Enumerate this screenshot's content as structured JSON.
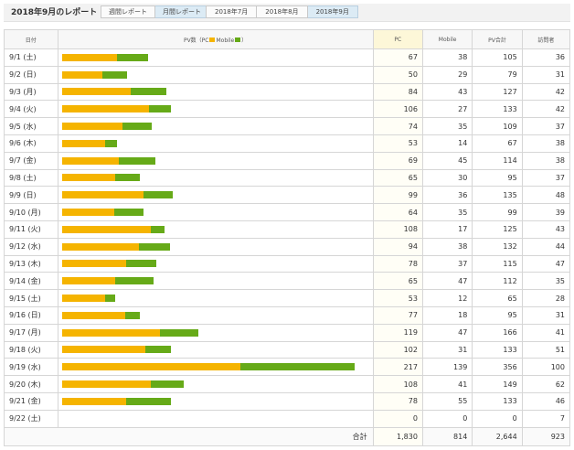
{
  "page_title": "2018年9月のレポート",
  "report_tabs": [
    "週間レポート",
    "月間レポート"
  ],
  "active_report_tab": 1,
  "month_tabs": [
    "2018年7月",
    "2018年8月",
    "2018年9月"
  ],
  "active_month_tab": 2,
  "colors": {
    "pc": "#f5b400",
    "mobile": "#66aa18"
  },
  "headers": {
    "date": "日付",
    "pv_prefix": "PV数（PC",
    "pv_mobile": "Mobile",
    "pv_suffix": "）",
    "pc": "PC",
    "mobile": "Mobile",
    "pv_total": "PV合計",
    "visitors": "訪問者"
  },
  "rows": [
    {
      "date": "9/1 (土)",
      "pc": "67",
      "mobile": "38",
      "total": "105",
      "visitors": "36",
      "pc_val": 67,
      "mobile_val": 38
    },
    {
      "date": "9/2 (日)",
      "pc": "50",
      "mobile": "29",
      "total": "79",
      "visitors": "31",
      "pc_val": 50,
      "mobile_val": 29
    },
    {
      "date": "9/3 (月)",
      "pc": "84",
      "mobile": "43",
      "total": "127",
      "visitors": "42",
      "pc_val": 84,
      "mobile_val": 43
    },
    {
      "date": "9/4 (火)",
      "pc": "106",
      "mobile": "27",
      "total": "133",
      "visitors": "42",
      "pc_val": 106,
      "mobile_val": 27
    },
    {
      "date": "9/5 (水)",
      "pc": "74",
      "mobile": "35",
      "total": "109",
      "visitors": "37",
      "pc_val": 74,
      "mobile_val": 35
    },
    {
      "date": "9/6 (木)",
      "pc": "53",
      "mobile": "14",
      "total": "67",
      "visitors": "38",
      "pc_val": 53,
      "mobile_val": 14
    },
    {
      "date": "9/7 (金)",
      "pc": "69",
      "mobile": "45",
      "total": "114",
      "visitors": "38",
      "pc_val": 69,
      "mobile_val": 45
    },
    {
      "date": "9/8 (土)",
      "pc": "65",
      "mobile": "30",
      "total": "95",
      "visitors": "37",
      "pc_val": 65,
      "mobile_val": 30
    },
    {
      "date": "9/9 (日)",
      "pc": "99",
      "mobile": "36",
      "total": "135",
      "visitors": "48",
      "pc_val": 99,
      "mobile_val": 36
    },
    {
      "date": "9/10 (月)",
      "pc": "64",
      "mobile": "35",
      "total": "99",
      "visitors": "39",
      "pc_val": 64,
      "mobile_val": 35
    },
    {
      "date": "9/11 (火)",
      "pc": "108",
      "mobile": "17",
      "total": "125",
      "visitors": "43",
      "pc_val": 108,
      "mobile_val": 17
    },
    {
      "date": "9/12 (水)",
      "pc": "94",
      "mobile": "38",
      "total": "132",
      "visitors": "44",
      "pc_val": 94,
      "mobile_val": 38
    },
    {
      "date": "9/13 (木)",
      "pc": "78",
      "mobile": "37",
      "total": "115",
      "visitors": "47",
      "pc_val": 78,
      "mobile_val": 37
    },
    {
      "date": "9/14 (金)",
      "pc": "65",
      "mobile": "47",
      "total": "112",
      "visitors": "35",
      "pc_val": 65,
      "mobile_val": 47
    },
    {
      "date": "9/15 (土)",
      "pc": "53",
      "mobile": "12",
      "total": "65",
      "visitors": "28",
      "pc_val": 53,
      "mobile_val": 12
    },
    {
      "date": "9/16 (日)",
      "pc": "77",
      "mobile": "18",
      "total": "95",
      "visitors": "31",
      "pc_val": 77,
      "mobile_val": 18
    },
    {
      "date": "9/17 (月)",
      "pc": "119",
      "mobile": "47",
      "total": "166",
      "visitors": "41",
      "pc_val": 119,
      "mobile_val": 47
    },
    {
      "date": "9/18 (火)",
      "pc": "102",
      "mobile": "31",
      "total": "133",
      "visitors": "51",
      "pc_val": 102,
      "mobile_val": 31
    },
    {
      "date": "9/19 (水)",
      "pc": "217",
      "mobile": "139",
      "total": "356",
      "visitors": "100",
      "pc_val": 217,
      "mobile_val": 139
    },
    {
      "date": "9/20 (木)",
      "pc": "108",
      "mobile": "41",
      "total": "149",
      "visitors": "62",
      "pc_val": 108,
      "mobile_val": 41
    },
    {
      "date": "9/21 (金)",
      "pc": "78",
      "mobile": "55",
      "total": "133",
      "visitors": "46",
      "pc_val": 78,
      "mobile_val": 55
    },
    {
      "date": "9/22 (土)",
      "pc": "0",
      "mobile": "0",
      "total": "0",
      "visitors": "7",
      "pc_val": 0,
      "mobile_val": 0
    }
  ],
  "totals": {
    "label": "合計",
    "pc": "1,830",
    "mobile": "814",
    "pv_total": "2,644",
    "visitors": "923"
  },
  "bar_scale_max": 356
}
